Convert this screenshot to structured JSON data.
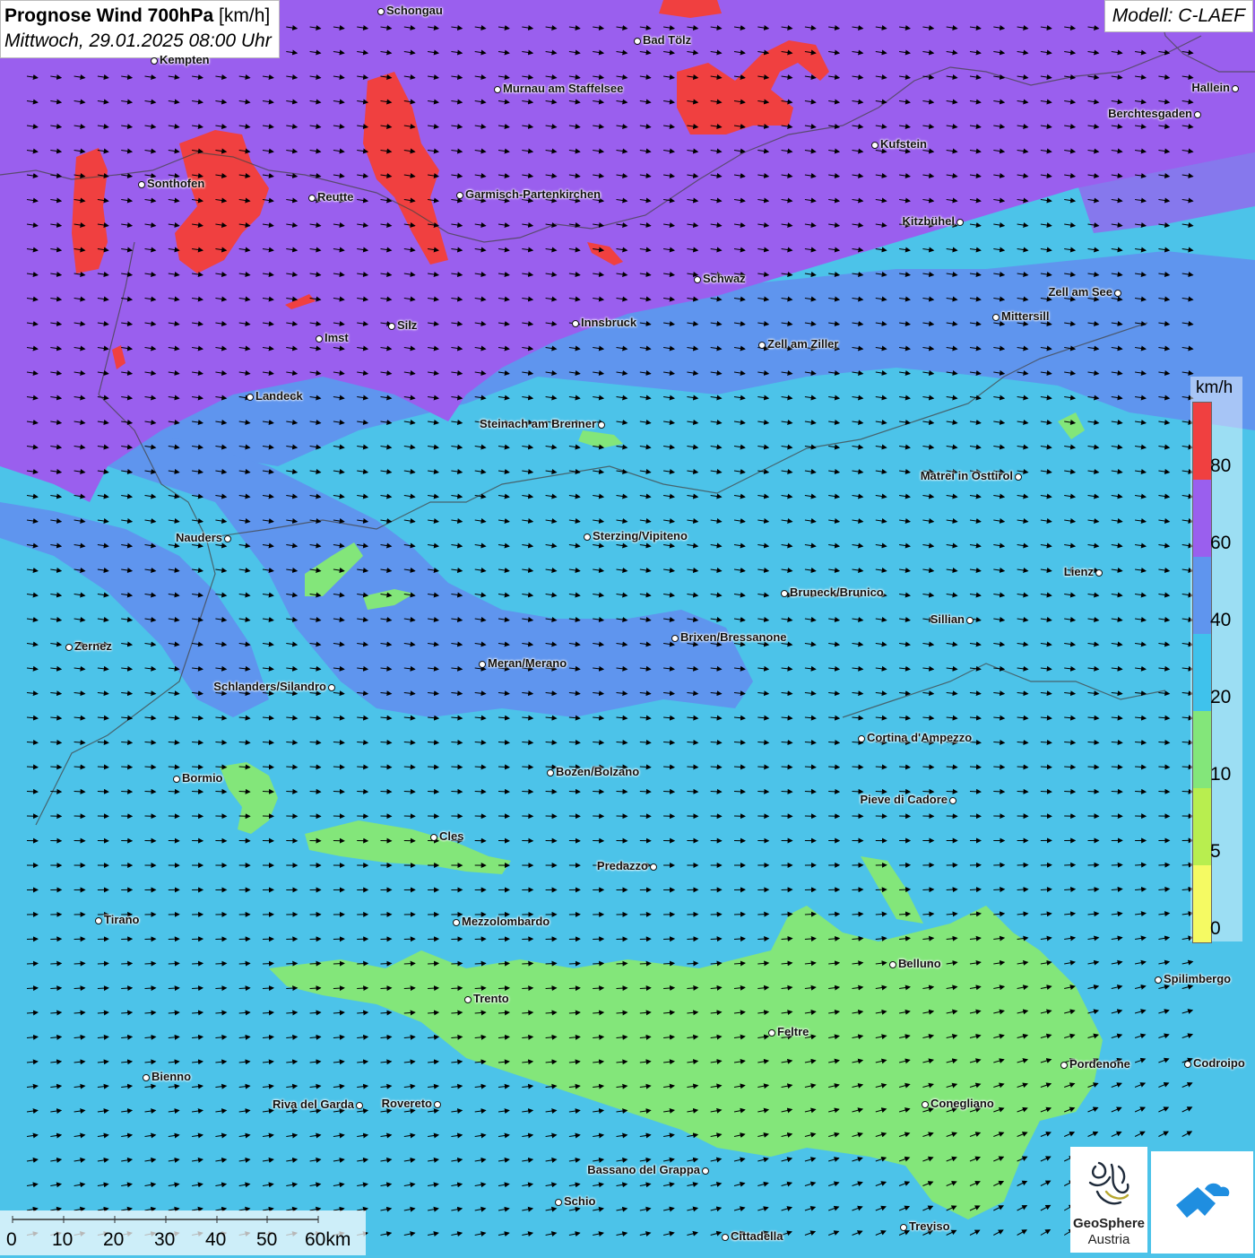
{
  "title": {
    "main": "Prognose Wind 700hPa",
    "unit": "[km/h]",
    "datetime": "Mittwoch, 29.01.2025 08:00 Uhr"
  },
  "model": "Modell: C-LAEF",
  "legend": {
    "unit": "km/h",
    "ticks": [
      "80",
      "60",
      "40",
      "20",
      "10",
      "5",
      "0"
    ],
    "colors": [
      "#f5fa63",
      "#b8ee4f",
      "#83e67a",
      "#3fc2ec",
      "#5f95ee",
      "#9a5fee",
      "#f04040"
    ]
  },
  "scale_bar": {
    "labels": [
      "0",
      "10",
      "20",
      "30",
      "40",
      "50",
      "60km"
    ]
  },
  "logo": {
    "name": "GeoSphere",
    "name2": "Austria"
  },
  "cities": [
    {
      "name": "Schongau"
    },
    {
      "name": "Bad Tölz"
    },
    {
      "name": "Kempten"
    },
    {
      "name": "Murnau am Staffelsee"
    },
    {
      "name": "Hallein"
    },
    {
      "name": "Berchtesgaden"
    },
    {
      "name": "Kufstein"
    },
    {
      "name": "Sonthofen"
    },
    {
      "name": "Reutte"
    },
    {
      "name": "Garmisch-Partenkirchen"
    },
    {
      "name": "Kitzbühel"
    },
    {
      "name": "Schwaz"
    },
    {
      "name": "Zell am See"
    },
    {
      "name": "Mittersill"
    },
    {
      "name": "Innsbruck"
    },
    {
      "name": "Imst"
    },
    {
      "name": "Silz"
    },
    {
      "name": "Zell am Ziller"
    },
    {
      "name": "Landeck"
    },
    {
      "name": "Steinach am Brenner"
    },
    {
      "name": "Matrei in Osttirol"
    },
    {
      "name": "Nauders"
    },
    {
      "name": "Sterzing/Vipiteno"
    },
    {
      "name": "Lienz"
    },
    {
      "name": "Bruneck/Brunico"
    },
    {
      "name": "Sillian"
    },
    {
      "name": "Zernez"
    },
    {
      "name": "Brixen/Bressanone"
    },
    {
      "name": "Meran/Merano"
    },
    {
      "name": "Schlanders/Silandro"
    },
    {
      "name": "Cortina d'Ampezzo"
    },
    {
      "name": "Bozen/Bolzano"
    },
    {
      "name": "Bormio"
    },
    {
      "name": "Pieve di Cadore"
    },
    {
      "name": "Cles"
    },
    {
      "name": "Predazzo"
    },
    {
      "name": "Tirano"
    },
    {
      "name": "Mezzolombardo"
    },
    {
      "name": "Belluno"
    },
    {
      "name": "Spilimbergo"
    },
    {
      "name": "Trento"
    },
    {
      "name": "Feltre"
    },
    {
      "name": "Bienno"
    },
    {
      "name": "Pordenone"
    },
    {
      "name": "Codroipo"
    },
    {
      "name": "Riva del Garda"
    },
    {
      "name": "Rovereto"
    },
    {
      "name": "Conegliano"
    },
    {
      "name": "Bassano del Grappa"
    },
    {
      "name": "Schio"
    },
    {
      "name": "Treviso"
    },
    {
      "name": "Cittadella"
    }
  ]
}
